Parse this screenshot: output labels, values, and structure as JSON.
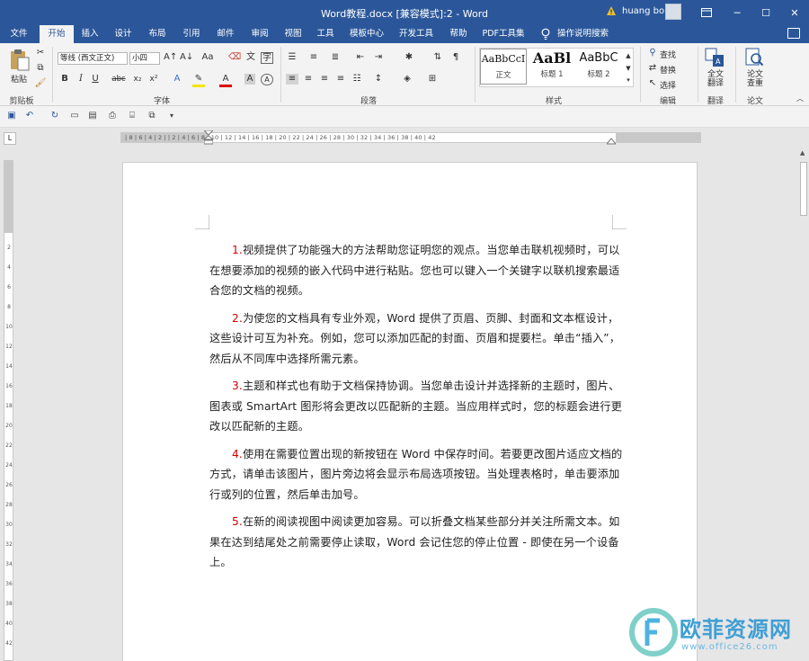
{
  "titlebar": {
    "title": "Word教程.docx [兼容模式]:2  -  Word",
    "user": "huang bo",
    "minimize": "─",
    "restore": "❐",
    "maximize": "☐",
    "close": "✕"
  },
  "tabs": [
    "文件",
    "开始",
    "插入",
    "设计",
    "布局",
    "引用",
    "邮件",
    "审阅",
    "视图",
    "工具",
    "模板中心",
    "开发工具",
    "帮助",
    "PDF工具集"
  ],
  "search_tab": "操作说明搜索",
  "ribbon": {
    "clipboard": {
      "paste": "粘贴",
      "label": "剪贴板"
    },
    "font": {
      "font_name": "等线 (西文正文)",
      "font_size": "小四",
      "bold": "B",
      "italic": "I",
      "underline": "U",
      "strike": "abc",
      "sub": "x₂",
      "sup": "x²",
      "grow": "A↑",
      "shrink": "A↓",
      "case": "Aa",
      "phonetic": "文",
      "color_a": "A",
      "border_a": "A",
      "circle": "字",
      "label": "字体"
    },
    "paragraph": {
      "label": "段落"
    },
    "styles": {
      "items": [
        {
          "sample": "AaBbCcI",
          "name": "正文"
        },
        {
          "sample": "AaBl",
          "name": "标题 1"
        },
        {
          "sample": "AaBbC",
          "name": "标题 2"
        }
      ],
      "label": "样式"
    },
    "editing": {
      "find": "查找",
      "replace": "替换",
      "select": "选择",
      "label": "编辑"
    },
    "translate": {
      "button": "全文\n翻译",
      "label": "翻译"
    },
    "paper": {
      "button": "论文\n查重",
      "label": "论文"
    }
  },
  "ruler": {
    "numbers": "|  8 |  6 |  4 |  2 |  |  2 |  4 |  6 |  8 | 10 | 12 | 14 | 16 | 18 | 20 | 22 | 24 | 26 | 28 | 30 | 32 | 34 | 36 | 38 | 40 | 42",
    "tab_selector": "L"
  },
  "vruler": {
    "numbers": [
      "2",
      "4",
      "6",
      "8",
      "10",
      "12",
      "14",
      "16",
      "18",
      "20",
      "22",
      "24",
      "26",
      "28",
      "30",
      "32",
      "34",
      "36",
      "38",
      "40",
      "42"
    ]
  },
  "document": {
    "paragraphs": [
      {
        "num": "1.",
        "text": "视频提供了功能强大的方法帮助您证明您的观点。当您单击联机视频时，可以在想要添加的视频的嵌入代码中进行粘贴。您也可以键入一个关键字以联机搜索最适合您的文档的视频。"
      },
      {
        "num": "2.",
        "text": "为使您的文档具有专业外观，Word 提供了页眉、页脚、封面和文本框设计，这些设计可互为补充。例如，您可以添加匹配的封面、页眉和提要栏。单击“插入”，然后从不同库中选择所需元素。"
      },
      {
        "num": "3.",
        "text": "主题和样式也有助于文档保持协调。当您单击设计并选择新的主题时，图片、图表或 SmartArt 图形将会更改以匹配新的主题。当应用样式时，您的标题会进行更改以匹配新的主题。"
      },
      {
        "num": "4.",
        "text": "使用在需要位置出现的新按钮在 Word 中保存时间。若要更改图片适应文档的方式，请单击该图片，图片旁边将会显示布局选项按钮。当处理表格时，单击要添加行或列的位置，然后单击加号。"
      },
      {
        "num": "5.",
        "text": "在新的阅读视图中阅读更加容易。可以折叠文档某些部分并关注所需文本。如果在达到结尾处之前需要停止读取，Word 会记住您的停止位置 - 即使在另一个设备上。"
      }
    ]
  },
  "watermark": {
    "title": "欧菲资源网",
    "url": "www.office26.com"
  },
  "colors": {
    "brand": "#2b579a",
    "number_red": "#d40000",
    "watermark": "#3f9fd4"
  }
}
